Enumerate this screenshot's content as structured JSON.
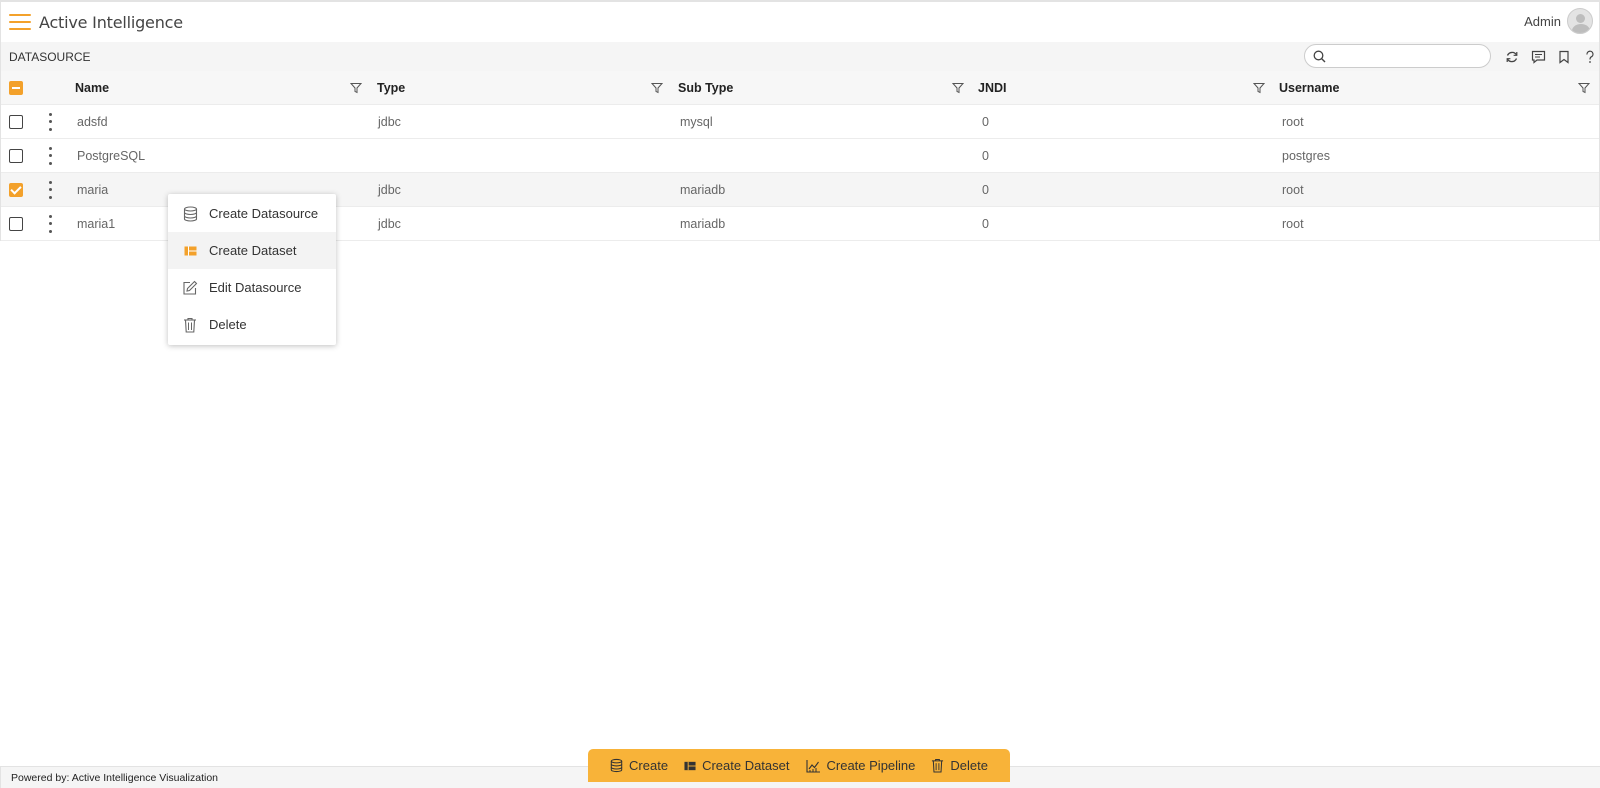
{
  "app": {
    "title": "Active Intelligence"
  },
  "user": {
    "name": "Admin"
  },
  "section": {
    "title": "DATASOURCE"
  },
  "search": {
    "placeholder": "",
    "value": ""
  },
  "toolbar_icons": [
    "refresh-icon",
    "comment-icon",
    "bookmark-icon",
    "help-icon"
  ],
  "colors": {
    "accent": "#f3a12b",
    "actionbar": "#f8b339"
  },
  "table": {
    "columns": [
      "Name",
      "Type",
      "Sub Type",
      "JNDI",
      "Username"
    ],
    "rows": [
      {
        "name": "adsfd",
        "type": "jdbc",
        "subtype": "mysql",
        "jndi": "0",
        "username": "root",
        "checked": false
      },
      {
        "name": "PostgreSQL",
        "type": "",
        "subtype": "",
        "jndi": "0",
        "username": "postgres",
        "checked": false
      },
      {
        "name": "maria",
        "type": "jdbc",
        "subtype": "mariadb",
        "jndi": "0",
        "username": "root",
        "checked": true
      },
      {
        "name": "maria1",
        "type": "jdbc",
        "subtype": "mariadb",
        "jndi": "0",
        "username": "root",
        "checked": false
      }
    ]
  },
  "context_menu": {
    "items": [
      {
        "label": "Create Datasource",
        "icon": "database-icon"
      },
      {
        "label": "Create Dataset",
        "icon": "dataset-icon"
      },
      {
        "label": "Edit Datasource",
        "icon": "edit-icon"
      },
      {
        "label": "Delete",
        "icon": "trash-icon"
      }
    ]
  },
  "actions": [
    {
      "label": "Create",
      "icon": "database-icon"
    },
    {
      "label": "Create Dataset",
      "icon": "dataset-icon"
    },
    {
      "label": "Create Pipeline",
      "icon": "pipeline-icon"
    },
    {
      "label": "Delete",
      "icon": "trash-icon"
    }
  ],
  "footer": {
    "text": "Powered by: Active Intelligence Visualization"
  }
}
